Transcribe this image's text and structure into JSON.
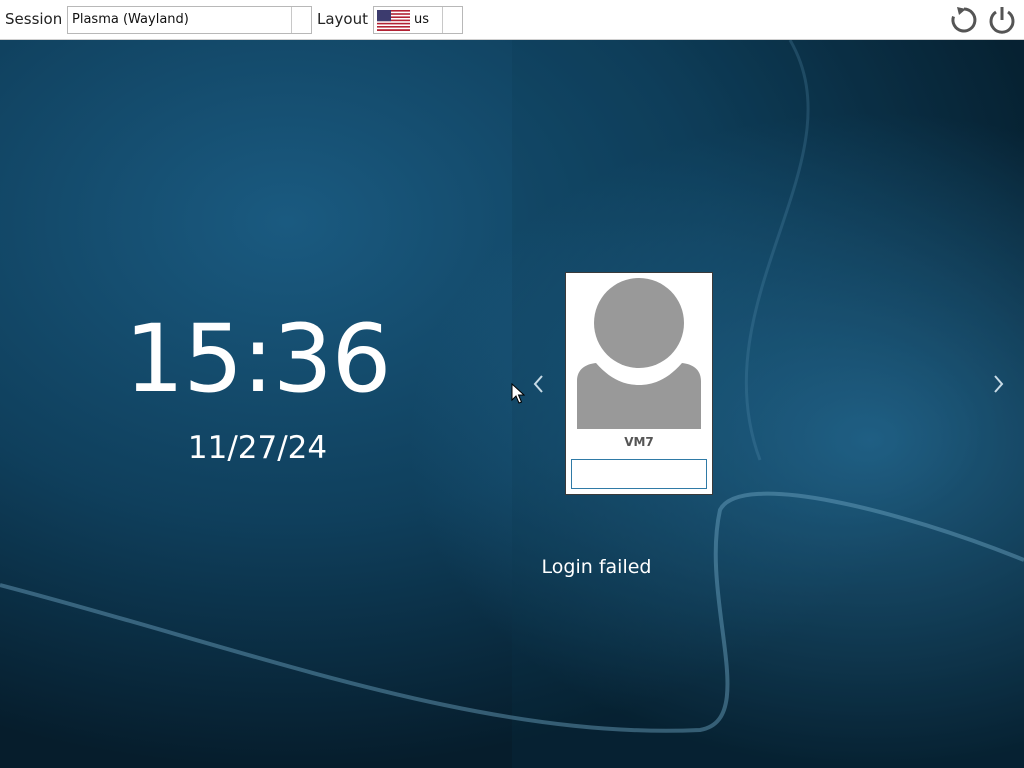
{
  "session": {
    "label": "Session",
    "selected": "Plasma (Wayland)"
  },
  "layout": {
    "label": "Layout",
    "selected": "us",
    "flag": "us-flag-icon"
  },
  "actions": {
    "restart_icon": "restart-icon",
    "shutdown_icon": "power-icon"
  },
  "clock": {
    "time": "15:36",
    "date": "11/27/24"
  },
  "user": {
    "name": "VM7",
    "password_value": "",
    "avatar_icon": "default-user-avatar-icon"
  },
  "navigation": {
    "prev_icon": "chevron-left-icon",
    "next_icon": "chevron-right-icon"
  },
  "status": {
    "message": "Login failed"
  },
  "colors": {
    "background": "#0f4463",
    "accent": "#2f7aa6",
    "avatar_gray": "#999999"
  }
}
